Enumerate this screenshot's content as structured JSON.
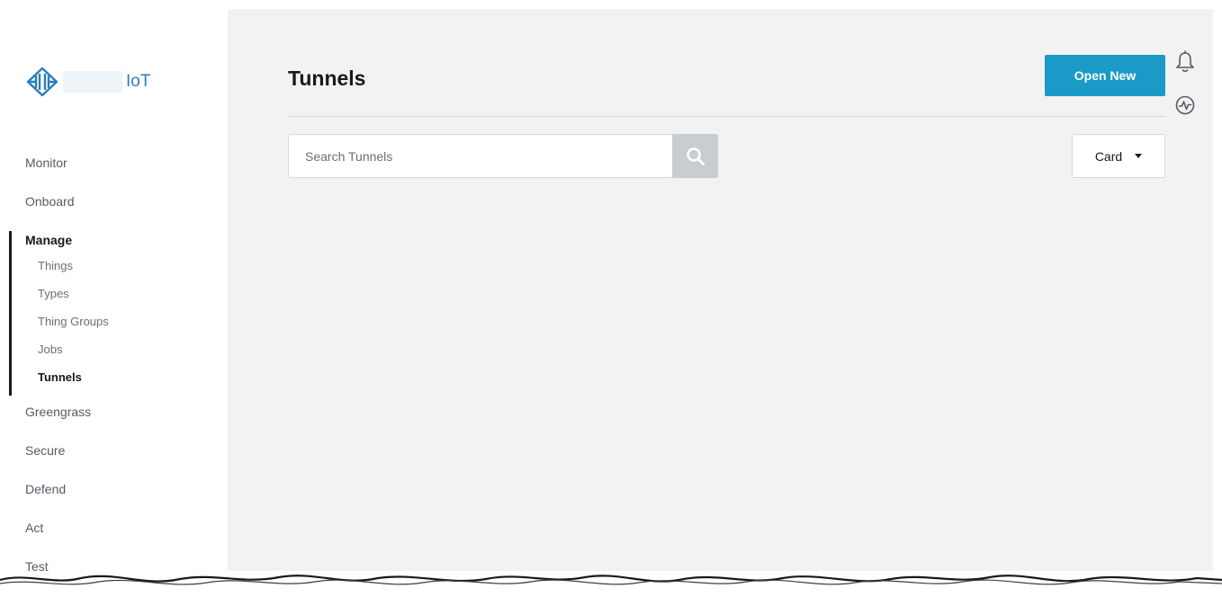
{
  "logo": {
    "text": "IoT",
    "icon": "iot-core-icon"
  },
  "sidebar": {
    "items": [
      {
        "label": "Monitor"
      },
      {
        "label": "Onboard"
      },
      {
        "label": "Manage",
        "active": true,
        "children": [
          {
            "label": "Things"
          },
          {
            "label": "Types"
          },
          {
            "label": "Thing Groups"
          },
          {
            "label": "Jobs"
          },
          {
            "label": "Tunnels",
            "current": true
          }
        ]
      },
      {
        "label": "Greengrass"
      },
      {
        "label": "Secure"
      },
      {
        "label": "Defend"
      },
      {
        "label": "Act"
      },
      {
        "label": "Test"
      }
    ]
  },
  "header": {
    "title": "Tunnels",
    "open_new_label": "Open New",
    "icons": [
      "bell-icon",
      "pulse-icon"
    ]
  },
  "search": {
    "placeholder": "Search Tunnels",
    "value": "",
    "icon": "search-icon"
  },
  "view": {
    "selected": "Card",
    "icon": "caret-down-icon"
  },
  "colors": {
    "accent": "#1a9bc7",
    "main_bg": "#f2f2f2",
    "search_button": "#c9cdd1"
  }
}
